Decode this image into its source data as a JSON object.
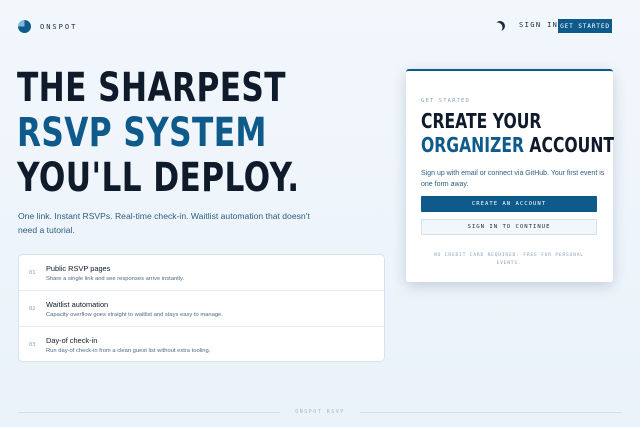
{
  "nav": {
    "brand": "ONSPOT",
    "sign_in": "SIGN IN",
    "get_started": "GET STARTED"
  },
  "hero": {
    "line1": "THE SHARPEST",
    "line2": "RSVP SYSTEM",
    "line3": "YOU'LL DEPLOY.",
    "lede": "One link. Instant RSVPs. Real-time check-in. Waitlist automation that doesn't need a tutorial."
  },
  "features": [
    {
      "num": "01",
      "title": "Public RSVP pages",
      "desc": "Share a single link and see responses arrive instantly."
    },
    {
      "num": "02",
      "title": "Waitlist automation",
      "desc": "Capacity overflow goes straight to waitlist and stays easy to manage."
    },
    {
      "num": "03",
      "title": "Day-of check-in",
      "desc": "Run day-of check-in from a clean guest list without extra tooling."
    }
  ],
  "card": {
    "eyebrow": "GET STARTED",
    "title_line1": "CREATE YOUR",
    "title_accent": "ORGANIZER",
    "title_rest": " ACCOUNT",
    "desc": "Sign up with email or connect via GitHub. Your first event is one form away.",
    "create_label": "CREATE AN ACCOUNT",
    "signin_label": "SIGN IN TO CONTINUE",
    "note": "NO CREDIT CARD REQUIRED. FREE FOR PERSONAL EVENTS."
  },
  "footer": {
    "text": "ONSPOT RSVP"
  },
  "colors": {
    "accent": "#0e5a8a",
    "text": "#0f1a2a",
    "muted": "#8aa2bb"
  },
  "icons": {
    "logo": "onspot-logo-icon",
    "theme": "moon-icon"
  }
}
